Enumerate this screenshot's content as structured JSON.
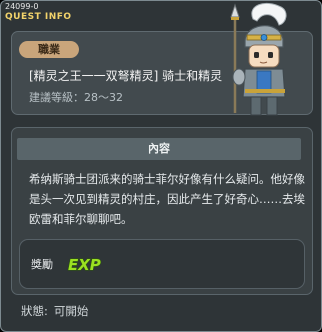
{
  "window": {
    "quest_id": "24099-0",
    "title": "QUEST INFO"
  },
  "header": {
    "job_badge": "職業",
    "quest_title": "[精灵之王一一双弩精灵] 骑士和精灵",
    "recommend_level": "建議等級：28～32",
    "npc_portrait": "knight-npc-portrait"
  },
  "content": {
    "header_label": "內容",
    "description": "希纳斯骑士团派来的骑士菲尔好像有什么疑问。他好像是头一次见到精灵的村庄，因此产生了好奇心……去埃欧雷和菲尔聊聊吧。"
  },
  "reward": {
    "label": "獎勵",
    "icon": "exp-icon",
    "icon_text": "EXP"
  },
  "status": {
    "label": "狀態:",
    "value": "可開始"
  },
  "colors": {
    "window_bg": "#2e3437",
    "title_accent": "#f2d36b",
    "badge_bg": "#c9a57b",
    "exp_green": "#8fd21e"
  }
}
